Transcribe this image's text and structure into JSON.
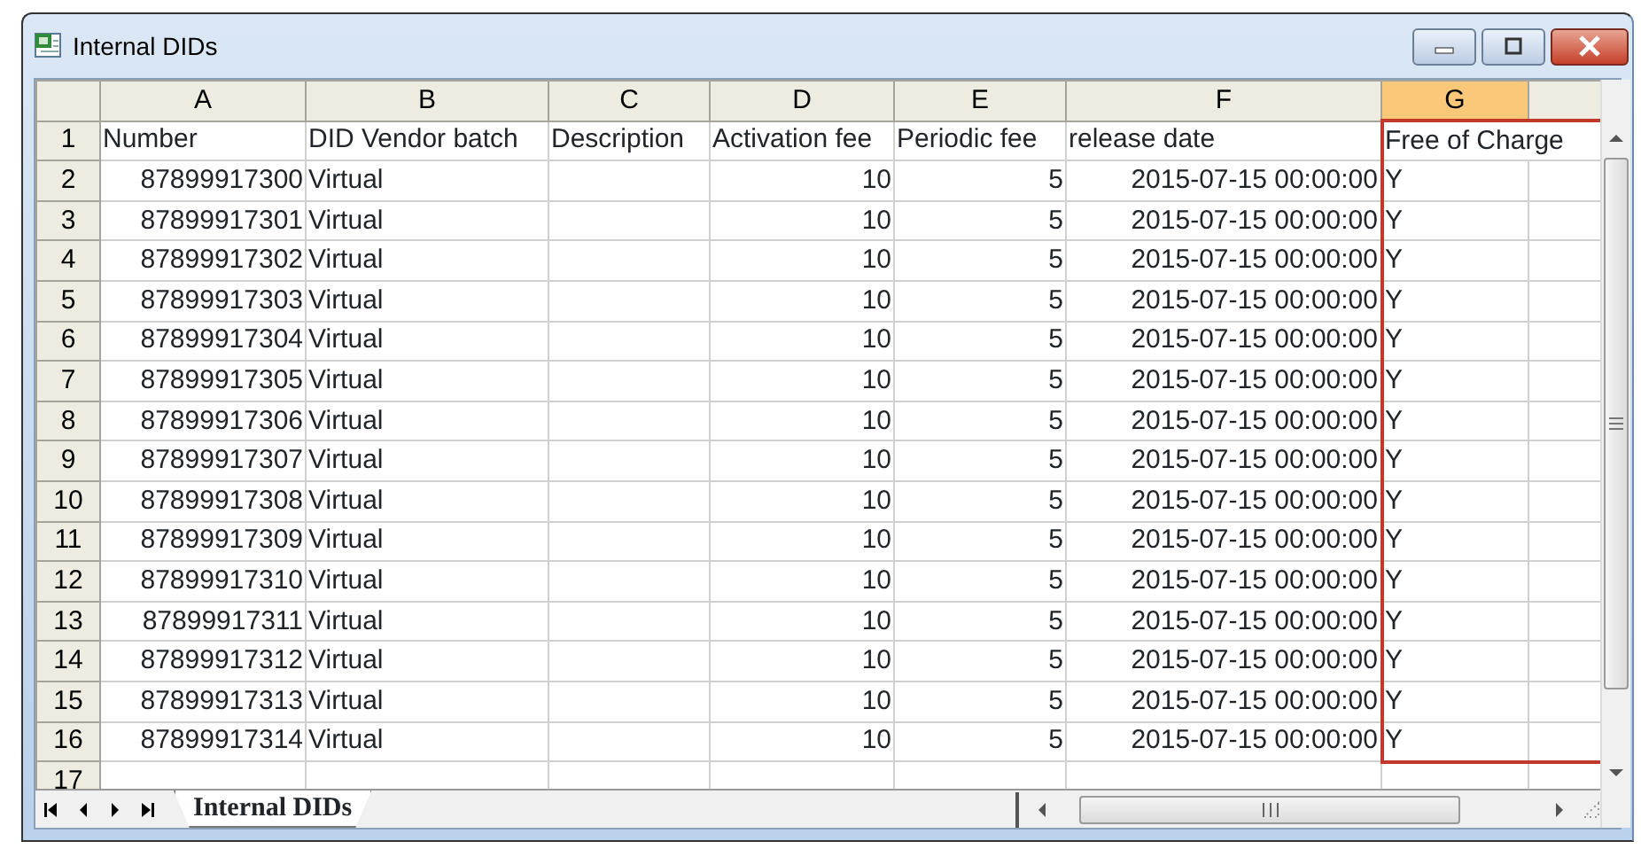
{
  "window": {
    "title": "Internal DIDs"
  },
  "columns": [
    {
      "letter": "A",
      "selected": false,
      "outlined": false
    },
    {
      "letter": "B",
      "selected": false,
      "outlined": false
    },
    {
      "letter": "C",
      "selected": false,
      "outlined": false
    },
    {
      "letter": "D",
      "selected": false,
      "outlined": false
    },
    {
      "letter": "E",
      "selected": false,
      "outlined": false
    },
    {
      "letter": "F",
      "selected": false,
      "outlined": false
    },
    {
      "letter": "G",
      "selected": true,
      "outlined": true
    },
    {
      "selected": false,
      "outlined": true
    }
  ],
  "rows": [
    {
      "number": "1",
      "kind": "header",
      "cells": [
        "Number",
        "DID Vendor batch",
        "Description",
        "Activation fee",
        "Periodic fee",
        "release date",
        "Free of Charge",
        ""
      ]
    },
    {
      "number": "2",
      "kind": "data",
      "cells": [
        "87899917300",
        "Virtual",
        "",
        "10",
        "5",
        "2015-07-15 00:00:00",
        "Y",
        ""
      ]
    },
    {
      "number": "3",
      "kind": "data",
      "cells": [
        "87899917301",
        "Virtual",
        "",
        "10",
        "5",
        "2015-07-15 00:00:00",
        "Y",
        ""
      ]
    },
    {
      "number": "4",
      "kind": "data",
      "cells": [
        "87899917302",
        "Virtual",
        "",
        "10",
        "5",
        "2015-07-15 00:00:00",
        "Y",
        ""
      ]
    },
    {
      "number": "5",
      "kind": "data",
      "cells": [
        "87899917303",
        "Virtual",
        "",
        "10",
        "5",
        "2015-07-15 00:00:00",
        "Y",
        ""
      ]
    },
    {
      "number": "6",
      "kind": "data",
      "cells": [
        "87899917304",
        "Virtual",
        "",
        "10",
        "5",
        "2015-07-15 00:00:00",
        "Y",
        ""
      ]
    },
    {
      "number": "7",
      "kind": "data",
      "cells": [
        "87899917305",
        "Virtual",
        "",
        "10",
        "5",
        "2015-07-15 00:00:00",
        "Y",
        ""
      ]
    },
    {
      "number": "8",
      "kind": "data",
      "cells": [
        "87899917306",
        "Virtual",
        "",
        "10",
        "5",
        "2015-07-15 00:00:00",
        "Y",
        ""
      ]
    },
    {
      "number": "9",
      "kind": "data",
      "cells": [
        "87899917307",
        "Virtual",
        "",
        "10",
        "5",
        "2015-07-15 00:00:00",
        "Y",
        ""
      ]
    },
    {
      "number": "10",
      "kind": "data",
      "cells": [
        "87899917308",
        "Virtual",
        "",
        "10",
        "5",
        "2015-07-15 00:00:00",
        "Y",
        ""
      ]
    },
    {
      "number": "11",
      "kind": "data",
      "cells": [
        "87899917309",
        "Virtual",
        "",
        "10",
        "5",
        "2015-07-15 00:00:00",
        "Y",
        ""
      ]
    },
    {
      "number": "12",
      "kind": "data",
      "cells": [
        "87899917310",
        "Virtual",
        "",
        "10",
        "5",
        "2015-07-15 00:00:00",
        "Y",
        ""
      ]
    },
    {
      "number": "13",
      "kind": "data",
      "cells": [
        "87899917311",
        "Virtual",
        "",
        "10",
        "5",
        "2015-07-15 00:00:00",
        "Y",
        ""
      ]
    },
    {
      "number": "14",
      "kind": "data",
      "cells": [
        "87899917312",
        "Virtual",
        "",
        "10",
        "5",
        "2015-07-15 00:00:00",
        "Y",
        ""
      ]
    },
    {
      "number": "15",
      "kind": "data",
      "cells": [
        "87899917313",
        "Virtual",
        "",
        "10",
        "5",
        "2015-07-15 00:00:00",
        "Y",
        ""
      ]
    },
    {
      "number": "16",
      "kind": "data",
      "cells": [
        "87899917314",
        "Virtual",
        "",
        "10",
        "5",
        "2015-07-15 00:00:00",
        "Y",
        ""
      ]
    },
    {
      "number": "17",
      "kind": "empty",
      "cells": []
    }
  ],
  "sheet_tabs": [
    {
      "label": "Internal DIDs",
      "selected": true
    }
  ]
}
